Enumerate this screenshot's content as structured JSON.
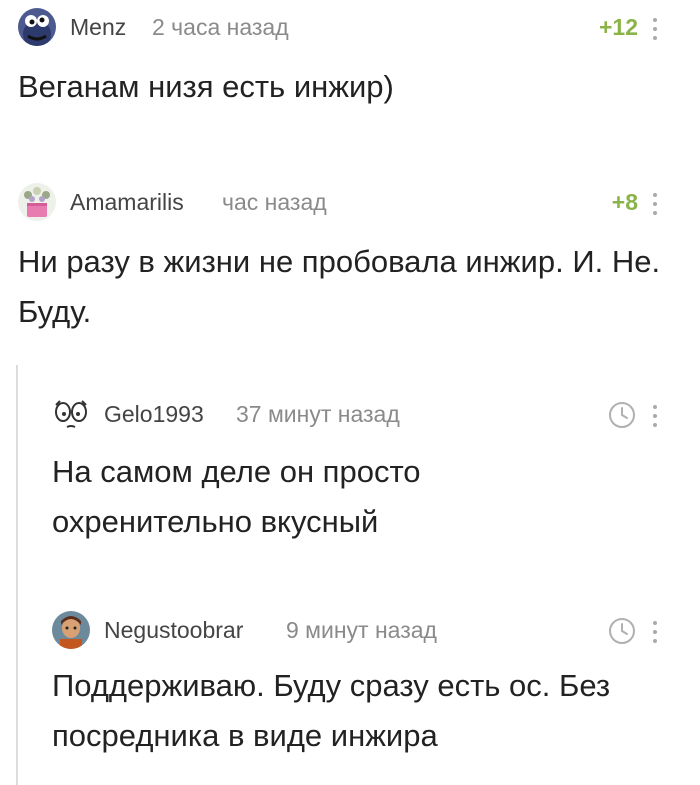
{
  "comments": [
    {
      "author": "Menz",
      "time": "2 часа назад",
      "rating": "+12",
      "text": "Веганам низя есть инжир)"
    },
    {
      "author": "Amamarilis",
      "time": "час назад",
      "rating": "+8",
      "text": "Ни разу в жизни не пробовала инжир. И. Не. Буду."
    },
    {
      "author": "Gelo1993",
      "time": "37 минут назад",
      "text": "На самом деле он просто охренительно вкусный"
    },
    {
      "author": "Negustoobrar",
      "time": "9 минут назад",
      "text": "Поддерживаю. Буду сразу есть ос. Без посредника в виде инжира"
    }
  ]
}
